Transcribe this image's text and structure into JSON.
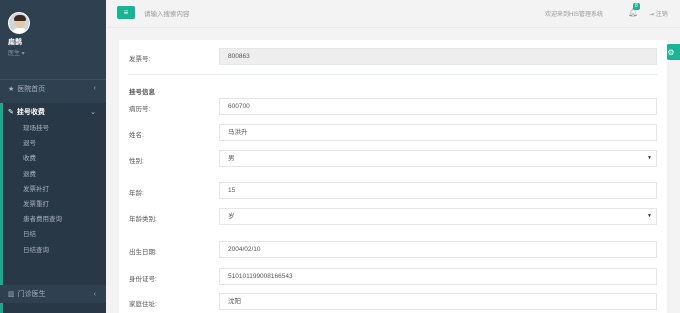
{
  "user": {
    "name": "扁鹊",
    "role": "医生 ▾"
  },
  "nav": {
    "home": "医院首页",
    "active_group": "挂号收费",
    "sub_items": [
      "现场挂号",
      "退号",
      "收费",
      "退费",
      "发票补打",
      "发票重打",
      "患者费用查询",
      "日结",
      "日结查询"
    ],
    "bottom_group": "门诊医生",
    "chevron_left": "‹",
    "chevron_down": "⌄"
  },
  "topbar": {
    "menu_icon": "≡",
    "search_placeholder": "请输入搜索内容",
    "welcome": "欢迎来到HIS管理系统",
    "notify_count": "8",
    "logout": "注销"
  },
  "form": {
    "invoice_label": "发票号:",
    "invoice_value": "800863",
    "section_title": "挂号信息",
    "record_label": "病历号:",
    "record_value": "600700",
    "name_label": "姓名:",
    "name_value": "马洪升",
    "gender_label": "性别:",
    "gender_value": "男",
    "age_label": "年龄:",
    "age_value": "15",
    "age_type_label": "年龄类别:",
    "age_type_value": "岁",
    "birth_label": "出生日期:",
    "birth_value": "2004/02/10",
    "id_label": "身份证号:",
    "id_value": "510101199008166543",
    "address_label": "家庭住址:",
    "address_value": "沈阳"
  },
  "colors": {
    "sidebar": "#2f4050",
    "accent": "#1ab394"
  }
}
